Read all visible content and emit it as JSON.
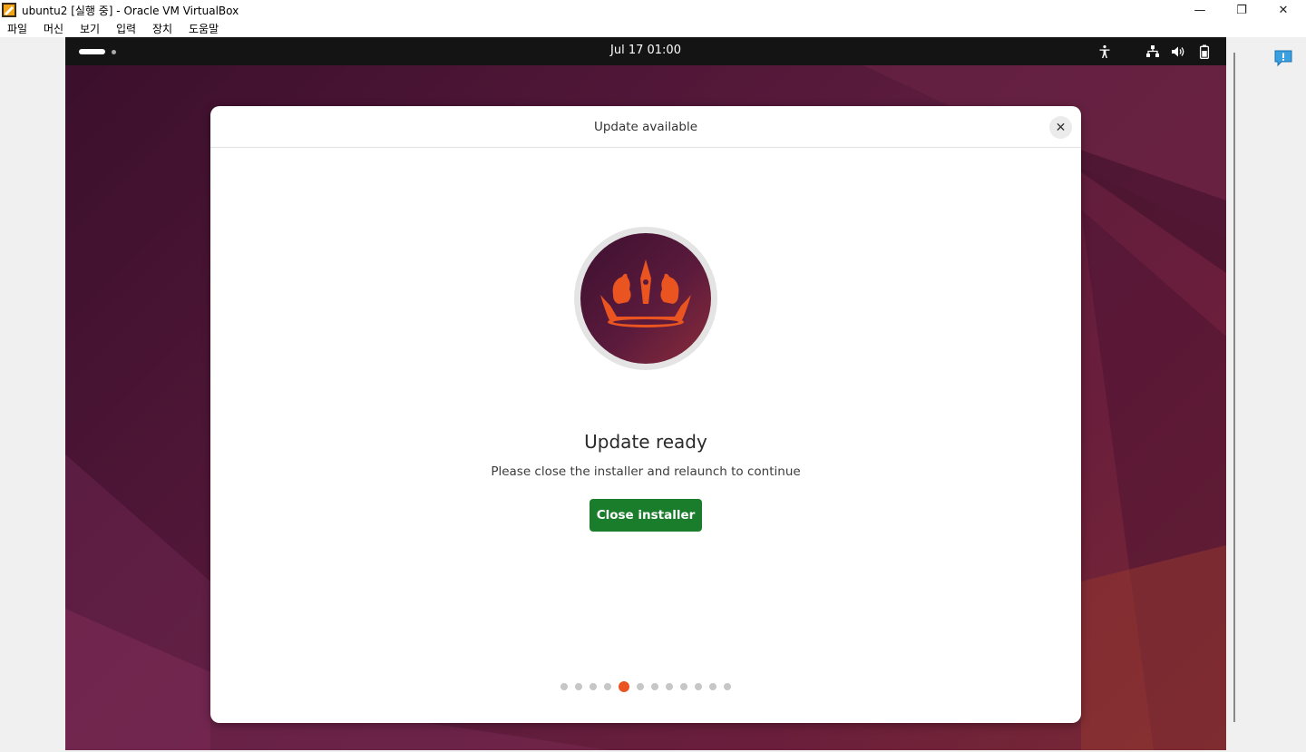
{
  "window": {
    "title": "ubuntu2 [실행 중] - Oracle VM VirtualBox",
    "minimize_glyph": "—",
    "restore_glyph": "❐",
    "close_glyph": "✕"
  },
  "menubar": {
    "items": [
      "파일",
      "머신",
      "보기",
      "입력",
      "장치",
      "도움말"
    ]
  },
  "vm": {
    "topbar": {
      "clock": "Jul 17  01:00",
      "tray_icons": [
        "accessibility-icon",
        "network-icon",
        "volume-icon",
        "battery-icon"
      ]
    },
    "dialog": {
      "title": "Update available",
      "close_glyph": "✕",
      "heading": "Update ready",
      "message": "Please close the installer and relaunch to continue",
      "button_label": "Close installer",
      "pager": {
        "total": 12,
        "active_index": 4
      }
    }
  },
  "colors": {
    "accent": "#e95420",
    "primary_button": "#1a7d2b",
    "topbar": "#141414"
  }
}
